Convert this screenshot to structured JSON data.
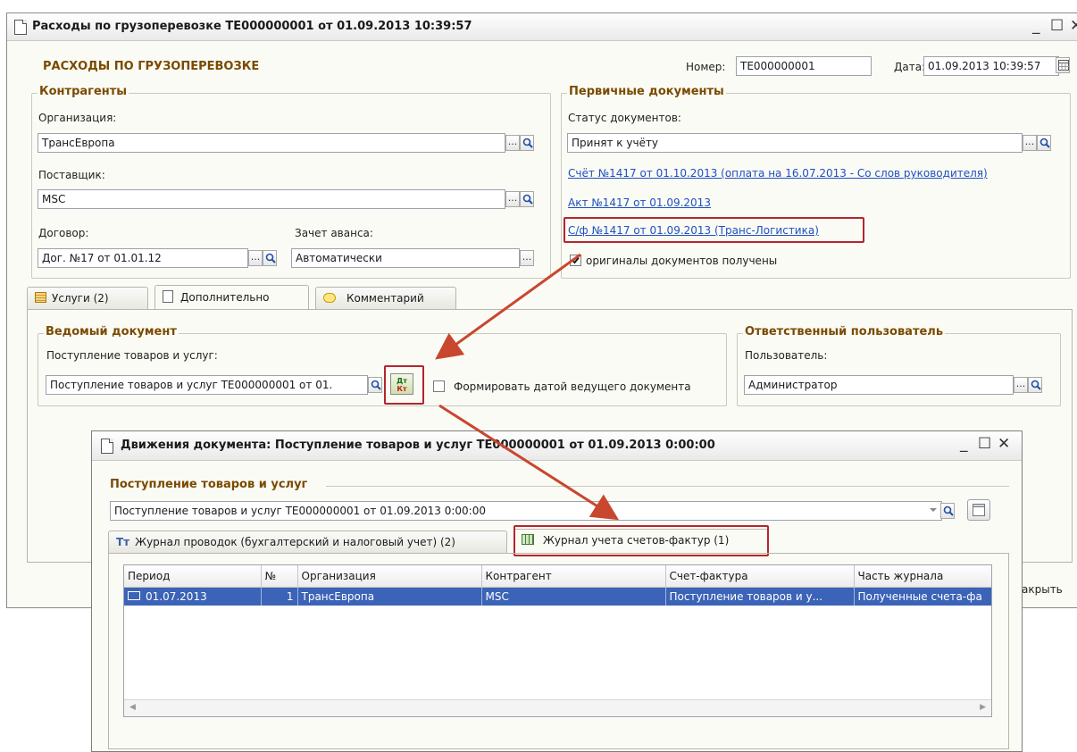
{
  "main_window": {
    "title": "Расходы по грузоперевозке ТЕ000000001 от 01.09.2013 10:39:57",
    "heading": "РАСХОДЫ ПО ГРУЗОПЕРЕВОЗКЕ",
    "number_label": "Номер:",
    "number_value": "ТЕ000000001",
    "date_label": "Дата:",
    "date_value": "01.09.2013 10:39:57",
    "counterparties": {
      "title": "Контрагенты",
      "org_label": "Организация:",
      "org_value": "ТрансЕвропа",
      "supplier_label": "Поставщик:",
      "supplier_value": "MSC",
      "contract_label": "Договор:",
      "contract_value": "Дог. №17 от 01.01.12",
      "advance_label": "Зачет аванса:",
      "advance_value": "Автоматически"
    },
    "primary_docs": {
      "title": "Первичные документы",
      "status_label": "Статус документов:",
      "status_value": "Принят к учёту",
      "link_invoice": "Счёт №1417 от 01.10.2013 (оплата на 16.07.2013 - Со слов руководителя)",
      "link_act": "Акт №1417 от 01.09.2013",
      "link_sf": "С/ф №1417 от 01.09.2013  (Транс-Логистика)",
      "originals_label": "оригиналы документов получены"
    },
    "tabs": [
      "Услуги (2)",
      "Дополнительно",
      "Комментарий"
    ],
    "led_doc": {
      "title": "Ведомый документ",
      "label": "Поступление товаров и услуг:",
      "value": "Поступление товаров и услуг ТЕ000000001 от 01.",
      "dtkt_top": "Дт",
      "dtkt_bottom": "Кт",
      "form_by_date_label": "Формировать датой ведущего документа"
    },
    "responsible": {
      "title": "Ответственный пользователь",
      "label": "Пользователь:",
      "value": "Администратор"
    },
    "close_partial": "акрыть"
  },
  "movements_window": {
    "title": "Движения документа: Поступление товаров и услуг ТЕ000000001 от 01.09.2013 0:00:00",
    "section_title": "Поступление товаров и услуг",
    "doc_value": "Поступление товаров и услуг ТЕ000000001 от 01.09.2013 0:00:00",
    "tabs": [
      "Журнал проводок (бухгалтерский и налоговый учет) (2)",
      "Журнал учета счетов-фактур (1)"
    ],
    "table": {
      "columns": [
        "Период",
        "№",
        "Организация",
        "Контрагент",
        "Счет-фактура",
        "Часть журнала"
      ],
      "rows": [
        [
          "01.07.2013",
          "1",
          "ТрансЕвропа",
          "MSC",
          "Поступление товаров и у...",
          "Полученные счета-фа"
        ]
      ]
    }
  },
  "colors": {
    "accent_brown": "#7a4a00",
    "link_blue": "#1f4fc1",
    "highlight_red": "#b3262c",
    "selection_blue": "#3b63b7"
  }
}
